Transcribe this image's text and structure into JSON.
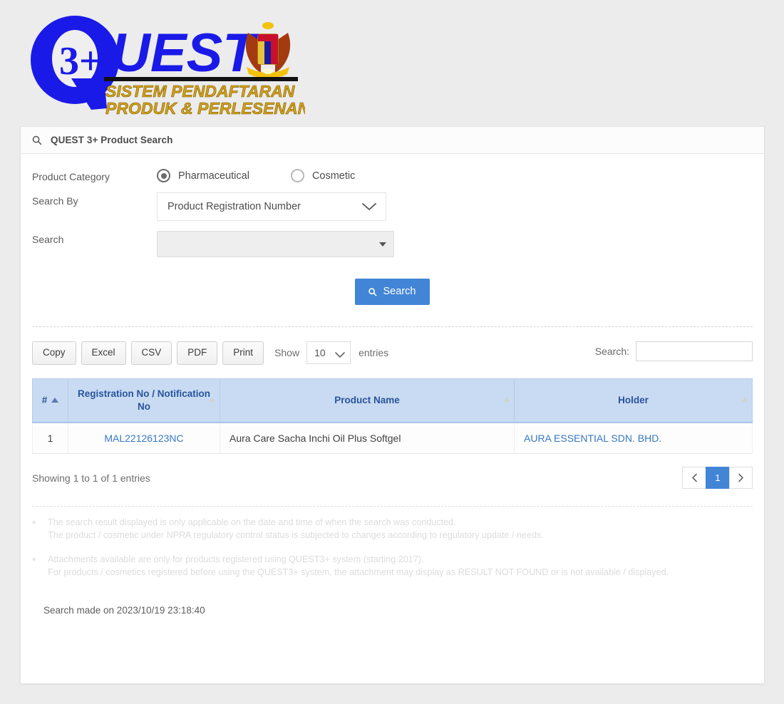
{
  "logo": {
    "brand_main": "QUEST",
    "brand_badge": "3+",
    "tagline_line1": "SISTEM PENDAFTARAN",
    "tagline_line2": "PRODUK & PERLESENAN",
    "crest_alt": "malaysia-coat-of-arms"
  },
  "card": {
    "header_title": "QUEST 3+ Product Search",
    "header_icon": "search-icon"
  },
  "form": {
    "category_label": "Product Category",
    "category_options": [
      {
        "label": "Pharmaceutical",
        "checked": true
      },
      {
        "label": "Cosmetic",
        "checked": false
      }
    ],
    "search_by_label": "Search By",
    "search_by_value": "Product Registration Number",
    "search_field_label": "Search",
    "search_field_value": "",
    "search_button_label": "Search",
    "search_button_icon": "search-icon",
    "search_button_color": "#4285d6"
  },
  "datatable": {
    "export_buttons": [
      "Copy",
      "Excel",
      "CSV",
      "PDF",
      "Print"
    ],
    "length_label_prefix": "Show",
    "length_value": "10",
    "length_label_suffix": "entries",
    "filter_label": "Search:",
    "filter_value": "",
    "filter_placeholder": "",
    "columns": [
      {
        "label": "#",
        "sorted": "asc"
      },
      {
        "label": "Registration No / Notification No",
        "sorted": "none"
      },
      {
        "label": "Product Name",
        "sorted": "none"
      },
      {
        "label": "Holder",
        "sorted": "none"
      }
    ],
    "rows": [
      {
        "index": "1",
        "registration_no": "MAL22126123NC",
        "product_name": "Aura Care Sacha Inchi Oil Plus Softgel",
        "holder": "AURA ESSENTIAL SDN. BHD."
      }
    ],
    "info_text": "Showing 1 to 1 of 1 entries",
    "pagination": {
      "previous_icon": "chevron-left-icon",
      "pages": [
        "1"
      ],
      "active_page": "1",
      "next_icon": "chevron-right-icon"
    },
    "header_bg": "#c9dbf2",
    "header_text_color": "#28539c",
    "link_color": "#3778c2"
  },
  "notes": [
    {
      "marker": "*",
      "lines": [
        "The search result displayed is only applicable on the date and time of when the search was conducted.",
        "The product / cosmetic under NPRA regulatory control status is subjected to changes according to regulatory update / needs."
      ]
    },
    {
      "marker": "*",
      "lines": [
        "Attachments available are only for products registered using QUEST3+ system (starting 2017).",
        "For products / cosmetics registered before using the QUEST3+ system, the attachment may display as RESULT NOT FOUND or is not available / displayed."
      ]
    }
  ],
  "search_made_on": "Search made on 2023/10/19 23:18:40"
}
